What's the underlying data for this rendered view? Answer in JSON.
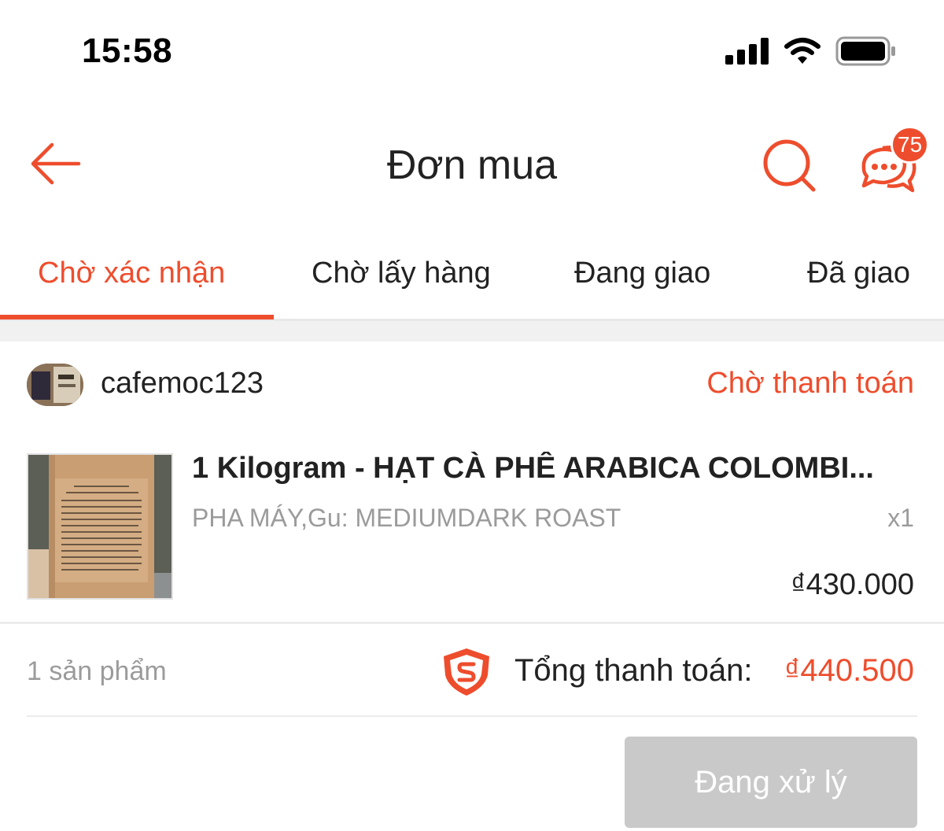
{
  "status_bar": {
    "time": "15:58",
    "icons": [
      "cellular-signal-icon",
      "wifi-icon",
      "battery-icon"
    ]
  },
  "header": {
    "title": "Đơn mua",
    "chat_badge_count": "75",
    "icons": [
      "back-arrow-icon",
      "search-icon",
      "chat-icon"
    ]
  },
  "tabs": [
    {
      "label": "Chờ xác nhận",
      "active": true
    },
    {
      "label": "Chờ lấy hàng",
      "active": false
    },
    {
      "label": "Đang giao",
      "active": false
    },
    {
      "label": "Đã giao",
      "active": false
    }
  ],
  "order": {
    "shop_name": "cafemoc123",
    "status": "Chờ thanh toán",
    "product": {
      "name": "1 Kilogram - HẠT CÀ PHÊ ARABICA COLOMBI...",
      "variant": "PHA MÁY,Gu: MEDIUMDARK ROAST",
      "quantity": "x1",
      "price": "₫430.000"
    },
    "item_count": "1 sản phẩm",
    "total_label": "Tổng thanh toán:",
    "total_amount": "₫440.500",
    "action_label": "Đang xử lý"
  },
  "colors": {
    "accent": "#ee4d2d",
    "muted_text": "#9b9b9b",
    "disabled_button": "#c9c9c9"
  }
}
